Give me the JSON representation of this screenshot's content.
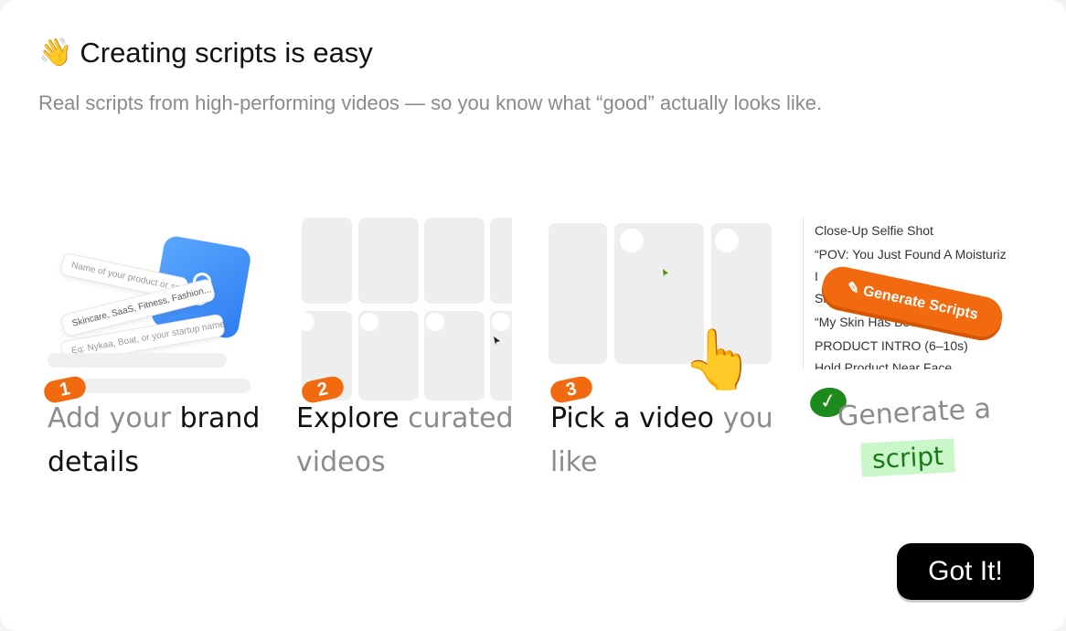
{
  "header": {
    "emoji": "👋",
    "title": "Creating scripts is easy",
    "subtitle": "Real scripts from high-performing videos — so you know what “good” actually looks like."
  },
  "steps": [
    {
      "number": "1",
      "text_muted": "Add your ",
      "text_strong": "brand details",
      "form_fields": [
        "Name of your product or service",
        "Skincare, SaaS, Fitness, Fashion...",
        "Eg: Nykaa, Boat, or your startup name"
      ]
    },
    {
      "number": "2",
      "text_strong": "Explore ",
      "text_muted": "curated videos"
    },
    {
      "number": "3",
      "text_strong": "Pick a video ",
      "text_muted": "you like",
      "hand": "👆"
    },
    {
      "check": "✓",
      "text_line1": "Generate a",
      "text_line2": "script",
      "button_label": "Generate Scripts",
      "script_lines": [
        "Close-Up Selfie Shot",
        "“POV: You Just Found A Moisturiz",
        "I",
        "Sh",
        "“My Skin Has Bee",
        "PRODUCT INTRO (6–10s)",
        "Hold Product Near Face"
      ]
    }
  ],
  "footer": {
    "got_it_label": "Got It!"
  },
  "colors": {
    "accent_orange": "#f26a0f",
    "success_green": "#1c8a1c",
    "highlight_green": "#c9f7c9"
  }
}
